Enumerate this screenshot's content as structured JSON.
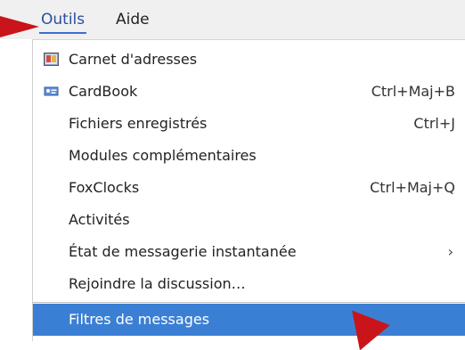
{
  "menubar": {
    "items": [
      {
        "label": "Outils"
      },
      {
        "label": "Aide"
      }
    ]
  },
  "menu": {
    "items": [
      {
        "label": "Carnet d'adresses",
        "icon": "address-book-icon",
        "shortcut": ""
      },
      {
        "label": "CardBook",
        "icon": "cardbook-icon",
        "shortcut": "Ctrl+Maj+B"
      },
      {
        "label": "Fichiers enregistrés",
        "icon": "",
        "shortcut": "Ctrl+J"
      },
      {
        "label": "Modules complémentaires",
        "icon": "",
        "shortcut": ""
      },
      {
        "label": "FoxClocks",
        "icon": "",
        "shortcut": "Ctrl+Maj+Q"
      },
      {
        "label": "Activités",
        "icon": "",
        "shortcut": ""
      },
      {
        "label": "État de messagerie instantanée",
        "icon": "",
        "submenu": "›"
      },
      {
        "label": "Rejoindre la discussion…",
        "icon": "",
        "shortcut": ""
      },
      {
        "label": "Filtres de messages",
        "icon": "",
        "shortcut": "",
        "highlighted": true
      }
    ]
  },
  "colors": {
    "highlight": "#3b7fd4",
    "pointer": "#c8141a",
    "menubar_bg": "#f0f0f0"
  }
}
